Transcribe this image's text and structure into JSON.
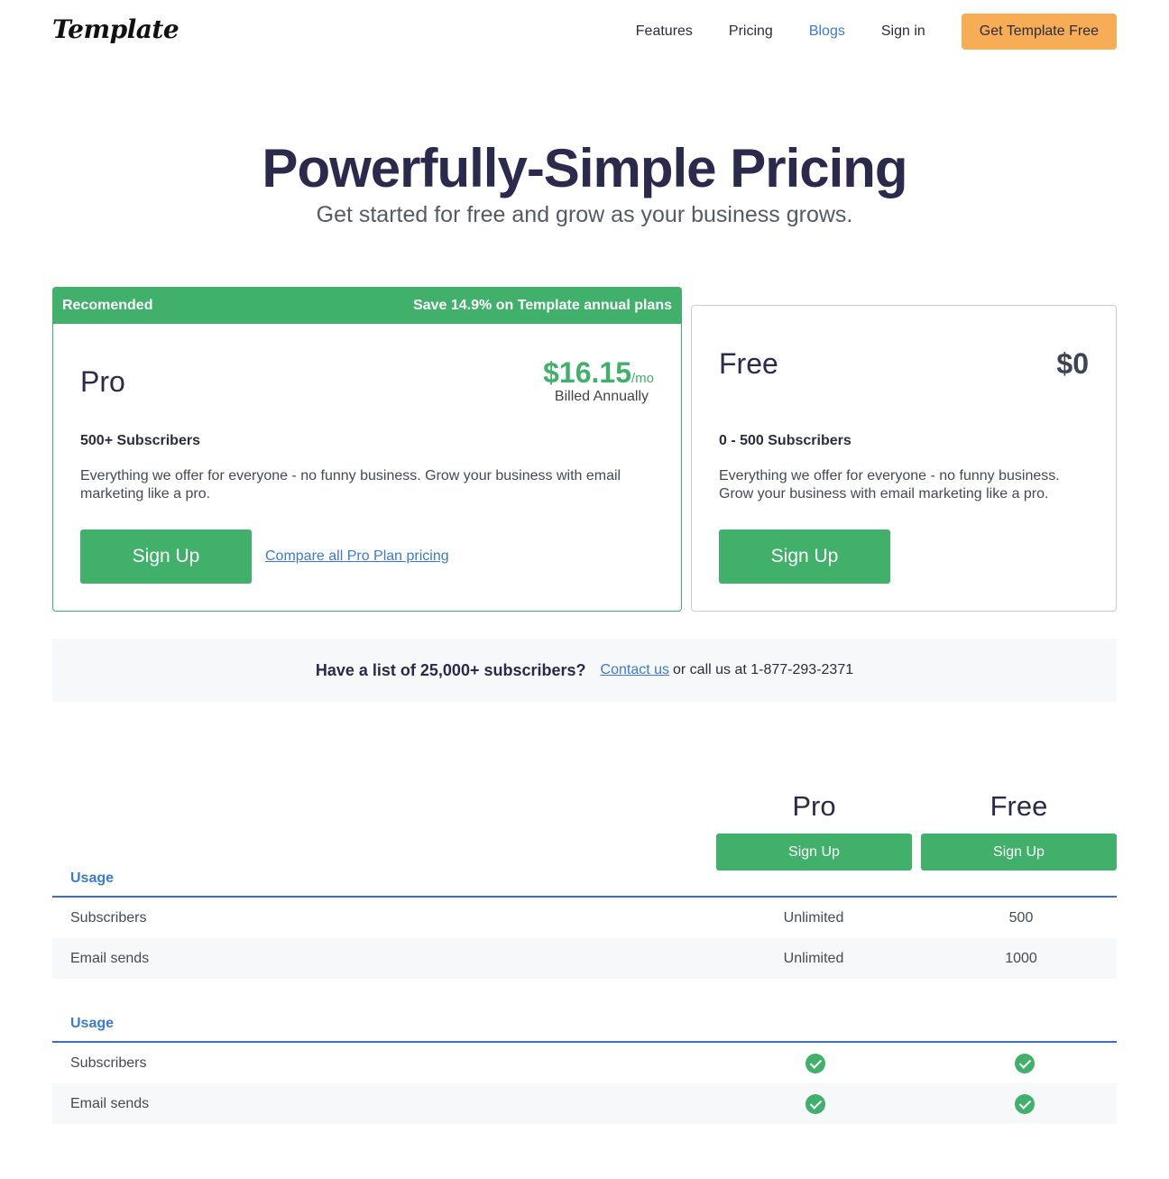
{
  "header": {
    "logo": "Template",
    "nav": [
      "Features",
      "Pricing",
      "Blogs",
      "Sign in"
    ],
    "active_nav": "Blogs",
    "cta": "Get Template Free"
  },
  "hero": {
    "title": "Powerfully-Simple Pricing",
    "subtitle": "Get started for free and grow as your business grows."
  },
  "pro_card": {
    "banner_left": "Recomended",
    "banner_right": "Save 14.9% on Template annual plans",
    "name": "Pro",
    "price": "$16.15",
    "price_unit": "/mo",
    "billing": "Billed Annually",
    "subscribers": "500+ Subscribers",
    "description": "Everything we offer for everyone - no funny business. Grow your business with email marketing like a pro.",
    "signup": "Sign Up",
    "compare_link": "Compare all Pro Plan pricing"
  },
  "free_card": {
    "name": "Free",
    "price": "$0",
    "subscribers": "0 - 500 Subscribers",
    "description": "Everything we offer for everyone - no funny business. Grow your business with email marketing like a pro.",
    "signup": "Sign Up"
  },
  "contact": {
    "question": "Have a list of 25,000+ subscribers?",
    "link": "Contact us",
    "text": "or call us at 1-877-293-2371"
  },
  "comparison": {
    "columns": [
      "Pro",
      "Free"
    ],
    "signup": "Sign Up",
    "sections": [
      {
        "label": "Usage",
        "rows": [
          {
            "name": "Subscribers",
            "pro": "Unlimited",
            "free": "500"
          },
          {
            "name": "Email sends",
            "pro": "Unlimited",
            "free": "1000"
          }
        ]
      },
      {
        "label": "Usage",
        "rows": [
          {
            "name": "Subscribers",
            "pro": "check-icon",
            "free": "check-icon"
          },
          {
            "name": "Email sends",
            "pro": "check-icon",
            "free": "check-icon"
          }
        ]
      }
    ]
  },
  "colors": {
    "green": "#41b06b",
    "orange": "#f6ad55",
    "blue": "#3a7bd5",
    "navy": "#2b2a4c"
  }
}
